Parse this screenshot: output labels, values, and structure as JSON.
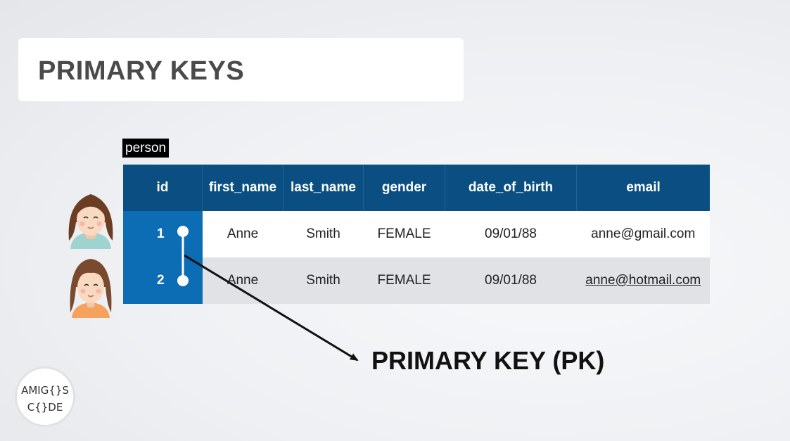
{
  "slide": {
    "title": "PRIMARY KEYS",
    "table_name": "person",
    "pk_label": "PRIMARY KEY (PK)"
  },
  "table": {
    "columns": [
      "id",
      "first_name",
      "last_name",
      "gender",
      "date_of_birth",
      "email"
    ],
    "rows": [
      {
        "id": "1",
        "first_name": "Anne",
        "last_name": "Smith",
        "gender": "FEMALE",
        "date_of_birth": "09/01/88",
        "email": "anne@gmail.com"
      },
      {
        "id": "2",
        "first_name": "Anne",
        "last_name": "Smith",
        "gender": "FEMALE",
        "date_of_birth": "09/01/88",
        "email": "anne@hotmail.com"
      }
    ]
  },
  "logo": {
    "line1": "AMIG{}S",
    "line2": "C{}DE"
  },
  "colors": {
    "header": "#0b4f82",
    "id_column": "#0c6db4",
    "row_alt": "#e0e2e6"
  },
  "icons": [
    "person-avatar-1",
    "person-avatar-2",
    "arrow"
  ]
}
